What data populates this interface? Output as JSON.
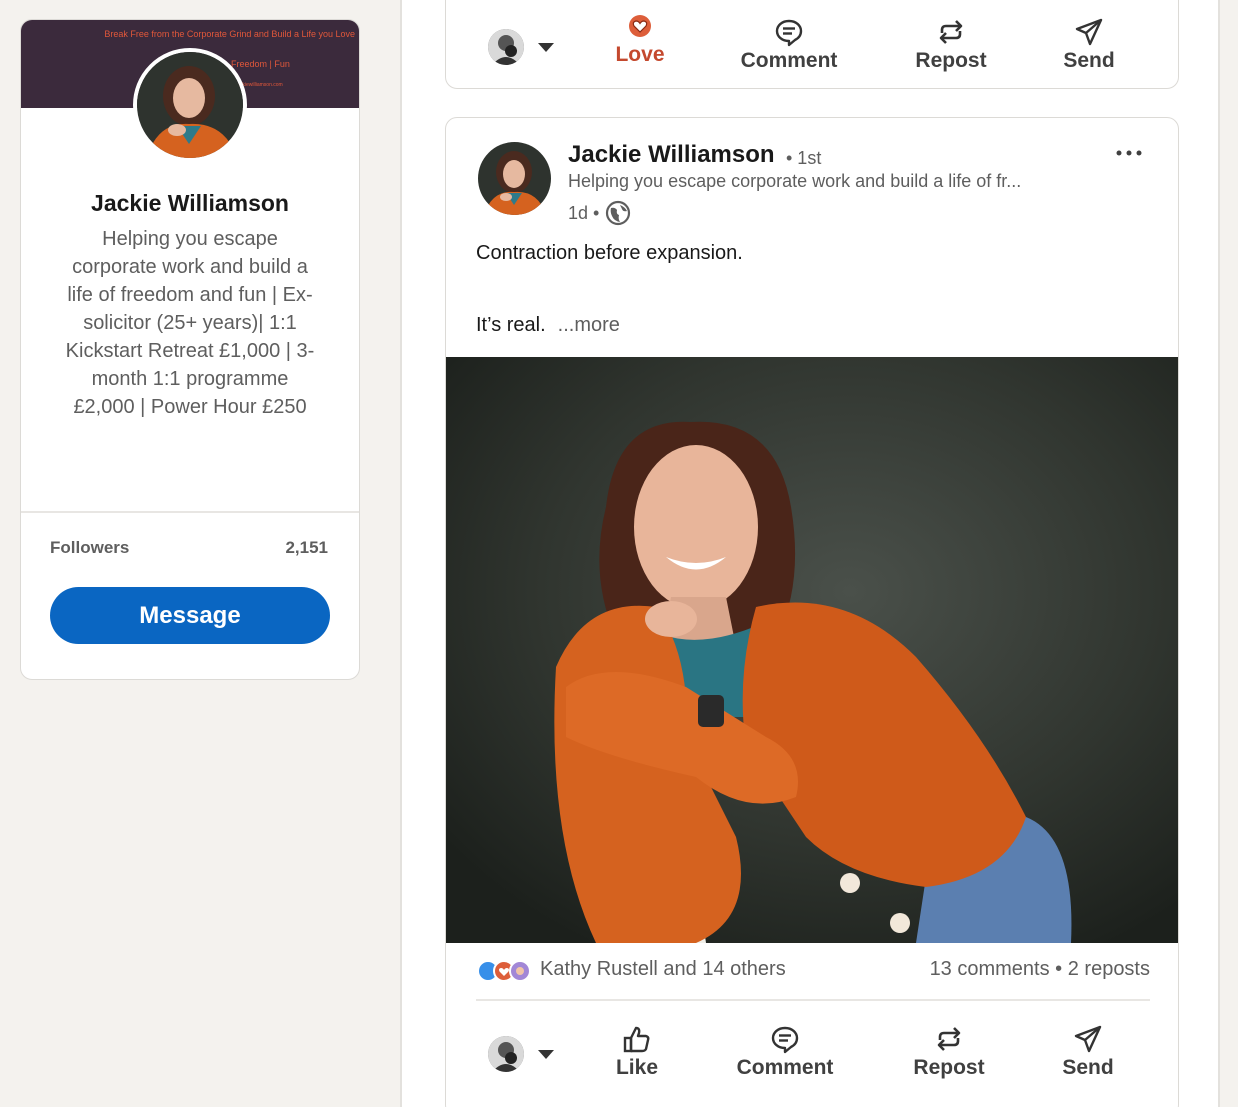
{
  "profile": {
    "banner_tagline": "Break Free from the Corporate Grind and Build a Life you Love",
    "banner_line2": "Freedom | Fun",
    "banner_line3": "jackiewilliamson.com",
    "name": "Jackie Williamson",
    "headline": "Helping you escape corporate work and build a life of freedom and fun | Ex-solicitor (25+ years)| 1:1 Kickstart Retreat £1,000 | 3-month 1:1 programme £2,000 | Power Hour £250",
    "followers_label": "Followers",
    "followers_count": "2,151",
    "message_label": "Message"
  },
  "previous_post_actions": {
    "love": "Love",
    "comment": "Comment",
    "repost": "Repost",
    "send": "Send"
  },
  "post": {
    "author": "Jackie Williamson",
    "degree": "• 1st",
    "headline": "Helping you escape corporate work and build a life of fr...",
    "time": "1d •",
    "text_line1": "Contraction before expansion.",
    "text_line2": "It’s real.",
    "more_label": "...more",
    "reactors": "Kathy Rustell and 14 others",
    "engagement": "13 comments • 2 reposts",
    "actions": {
      "like": "Like",
      "comment": "Comment",
      "repost": "Repost",
      "send": "Send"
    }
  },
  "colors": {
    "brand_blue": "#0a66c2",
    "love_red": "#c4492e",
    "cardigan_orange": "#d5621f"
  },
  "icons": [
    "more-icon",
    "globe-icon",
    "like-icon",
    "love-icon",
    "comment-icon",
    "repost-icon",
    "send-icon",
    "caret-down-icon"
  ]
}
